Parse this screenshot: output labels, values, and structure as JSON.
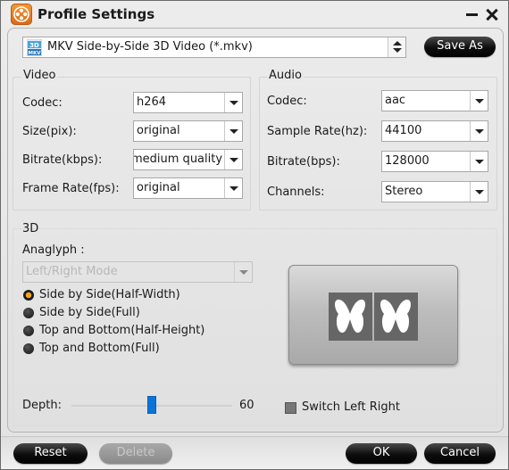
{
  "window": {
    "title": "Profile Settings",
    "minimize_icon": "minimize-icon",
    "close_icon": "close-icon"
  },
  "profile": {
    "selected": "MKV Side-by-Side 3D Video (*.mkv)",
    "format_icon": "mkv-3d-icon",
    "save_as_label": "Save As"
  },
  "video": {
    "title": "Video",
    "fields": [
      {
        "label": "Codec:",
        "value": "h264"
      },
      {
        "label": "Size(pix):",
        "value": "original"
      },
      {
        "label": "Bitrate(kbps):",
        "value": "medium quality"
      },
      {
        "label": "Frame Rate(fps):",
        "value": "original"
      }
    ]
  },
  "audio": {
    "title": "Audio",
    "fields": [
      {
        "label": "Codec:",
        "value": "aac"
      },
      {
        "label": "Sample Rate(hz):",
        "value": "44100"
      },
      {
        "label": "Bitrate(bps):",
        "value": "128000"
      },
      {
        "label": "Channels:",
        "value": "Stereo"
      }
    ]
  },
  "three_d": {
    "title": "3D",
    "anaglyph_label": "Anaglyph :",
    "anaglyph_value": "Left/Right Mode",
    "anaglyph_enabled": false,
    "modes": [
      {
        "label": "Side by Side(Half-Width)",
        "checked": true
      },
      {
        "label": "Side by Side(Full)",
        "checked": false
      },
      {
        "label": "Top and Bottom(Half-Height)",
        "checked": false
      },
      {
        "label": "Top and Bottom(Full)",
        "checked": false
      }
    ],
    "preview_icon": "butterfly-side-by-side-icon",
    "depth_label": "Depth:",
    "depth_value": "60",
    "depth_fraction": 0.5,
    "switch_left_right_label": "Switch Left Right",
    "switch_left_right_checked": false
  },
  "footer": {
    "reset_label": "Reset",
    "delete_label": "Delete",
    "delete_enabled": false,
    "ok_label": "OK",
    "cancel_label": "Cancel"
  },
  "colors": {
    "accent_orange": "#f39b3a",
    "slider_blue": "#0b74d9",
    "button_black": "#0d0d0d"
  }
}
